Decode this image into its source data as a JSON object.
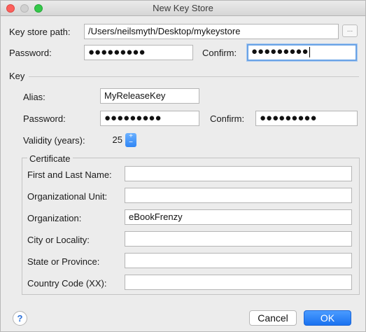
{
  "window": {
    "title": "New Key Store"
  },
  "keystore": {
    "path_label": "Key store path:",
    "path_value": "/Users/neilsmyth/Desktop/mykeystore",
    "browse_label": "...",
    "password_label": "Password:",
    "password_value": "●●●●●●●●●",
    "confirm_label": "Confirm:",
    "confirm_value": "●●●●●●●●●"
  },
  "key": {
    "section_label": "Key",
    "alias_label": "Alias:",
    "alias_value": "MyReleaseKey",
    "password_label": "Password:",
    "password_value": "●●●●●●●●●",
    "confirm_label": "Confirm:",
    "confirm_value": "●●●●●●●●●",
    "validity_label": "Validity (years):",
    "validity_value": "25"
  },
  "certificate": {
    "section_label": "Certificate",
    "fields": [
      {
        "label": "First and Last Name:",
        "value": ""
      },
      {
        "label": "Organizational Unit:",
        "value": ""
      },
      {
        "label": "Organization:",
        "value": "eBookFrenzy"
      },
      {
        "label": "City or Locality:",
        "value": ""
      },
      {
        "label": "State or Province:",
        "value": ""
      },
      {
        "label": "Country Code (XX):",
        "value": ""
      }
    ]
  },
  "footer": {
    "help_label": "?",
    "cancel_label": "Cancel",
    "ok_label": "OK"
  },
  "colors": {
    "accent": "#2f86f5",
    "focus_ring": "#6aa3e6"
  }
}
